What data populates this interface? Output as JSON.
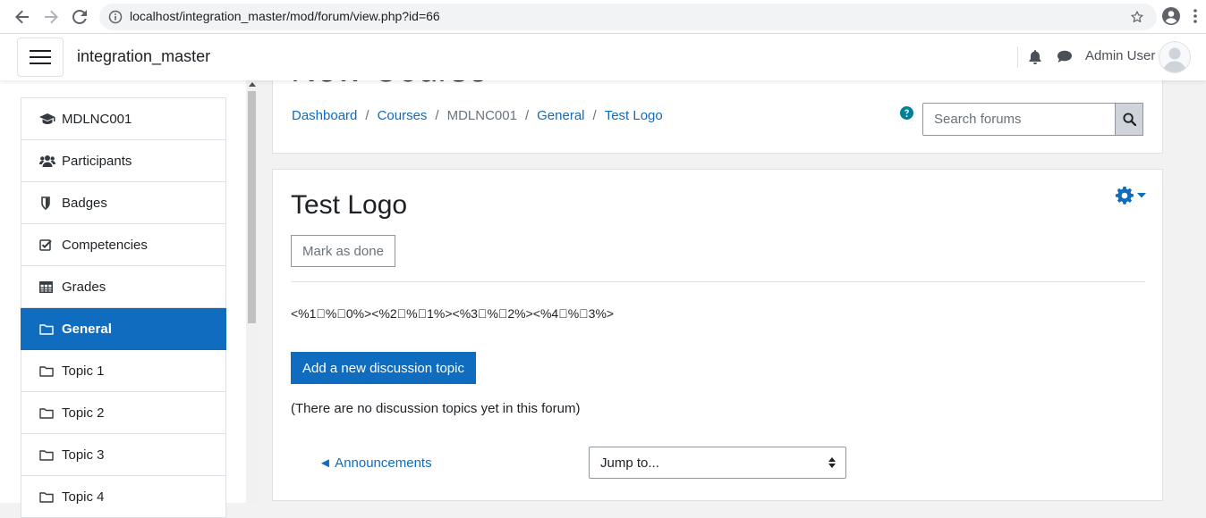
{
  "browser": {
    "url": "localhost/integration_master/mod/forum/view.php?id=66"
  },
  "navbar": {
    "site_name": "integration_master",
    "user_name": "Admin User"
  },
  "sidebar": {
    "items": [
      {
        "label": "MDLNC001",
        "icon": "graduation-cap-icon"
      },
      {
        "label": "Participants",
        "icon": "users-icon"
      },
      {
        "label": "Badges",
        "icon": "shield-icon"
      },
      {
        "label": "Competencies",
        "icon": "check-square-icon"
      },
      {
        "label": "Grades",
        "icon": "table-icon"
      },
      {
        "label": "General",
        "icon": "folder-icon",
        "active": true
      },
      {
        "label": "Topic 1",
        "icon": "folder-icon"
      },
      {
        "label": "Topic 2",
        "icon": "folder-icon"
      },
      {
        "label": "Topic 3",
        "icon": "folder-icon"
      },
      {
        "label": "Topic 4",
        "icon": "folder-icon"
      }
    ]
  },
  "header": {
    "course_title": "New Course",
    "breadcrumb": [
      "Dashboard",
      "Courses",
      "MDLNC001",
      "General",
      "Test Logo"
    ],
    "search_placeholder": "Search forums"
  },
  "main": {
    "title": "Test Logo",
    "mark_done_label": "Mark as done",
    "intro_text": "<%1\u0000%\u00000%><%2\u0000%\u00001%><%3\u0000%\u00002%><%4\u0000%\u00003%>",
    "add_topic_label": "Add a new discussion topic",
    "no_topics_text": "(There are no discussion topics yet in this forum)",
    "prev_activity_label": "◄ Announcements",
    "jump_to_label": "Jump to..."
  },
  "colors": {
    "accent": "#0f6cbf",
    "help_icon": "#008196"
  }
}
